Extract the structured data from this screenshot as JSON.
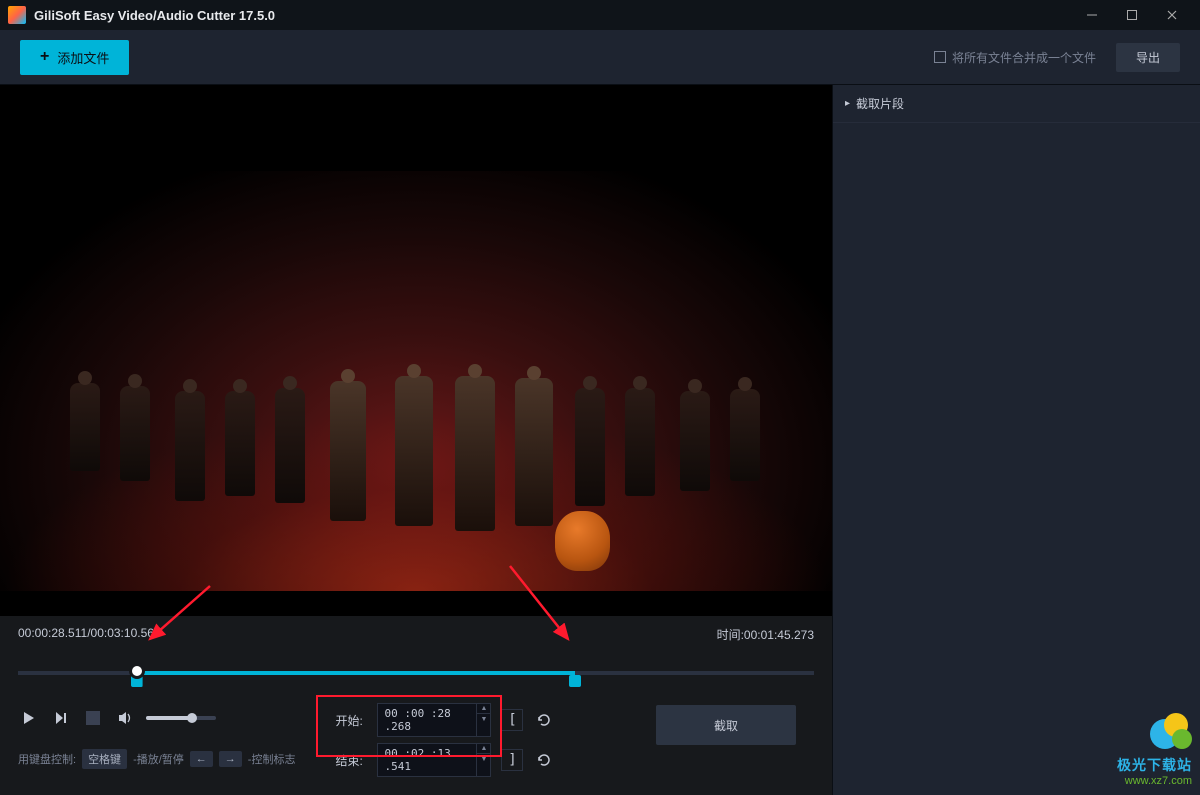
{
  "title_bar": {
    "app_title": "GiliSoft Easy Video/Audio Cutter 17.5.0"
  },
  "toolbar": {
    "add_file_label": "添加文件",
    "merge_label": "将所有文件合并成一个文件",
    "export_label": "导出"
  },
  "side_panel": {
    "header": "截取片段"
  },
  "timeline": {
    "current_time": "00:00:28.511",
    "total_time": "00:03:10.564",
    "selection_time_label": "时间",
    "selection_time": "00:01:45.273",
    "playhead_percent": 14.9,
    "sel_start_percent": 14.9,
    "sel_end_percent": 70
  },
  "controls": {
    "start_label": "开始:",
    "start_value": "00 :00 :28 .268",
    "end_label": "结束:",
    "end_value": "00 :02 :13 .541",
    "cut_label": "截取",
    "kb_label": "用键盘控制:",
    "kb_space": "空格键",
    "kb_playpause": "-播放/暂停",
    "kb_marks": "-控制标志",
    "volume_percent": 65
  },
  "watermark": {
    "line1": "极光下载站",
    "line2": "www.xz7.com"
  }
}
